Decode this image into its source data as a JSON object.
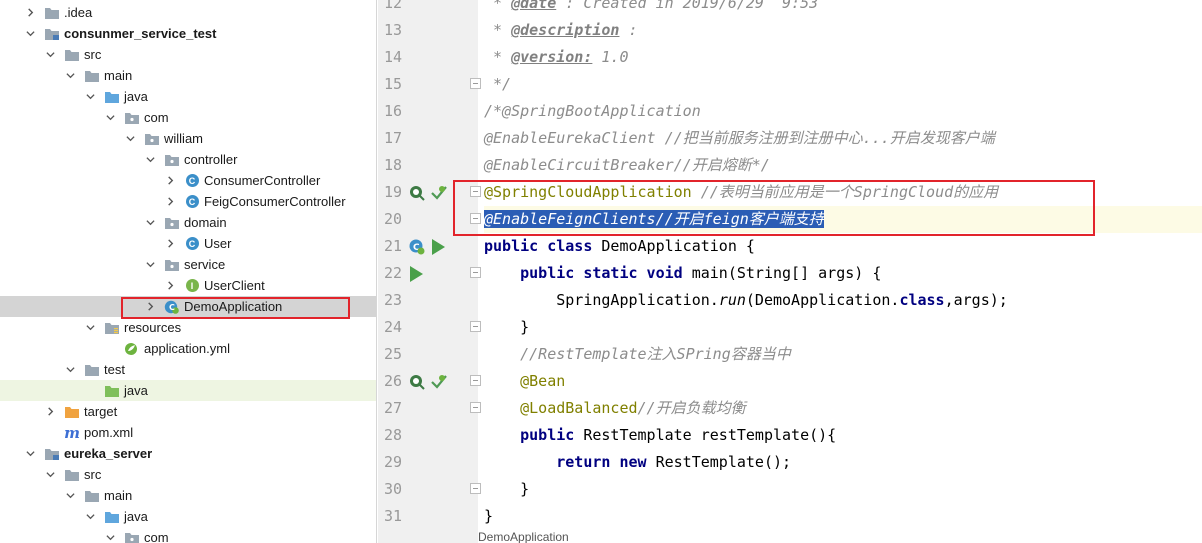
{
  "tree": {
    "items": [
      {
        "label": ".idea",
        "indent": 0,
        "arrow": "right",
        "icon": "folder-plain",
        "bold": false
      },
      {
        "label": "consunmer_service_test",
        "indent": 0,
        "arrow": "down",
        "icon": "folder-module",
        "bold": true
      },
      {
        "label": "src",
        "indent": 1,
        "arrow": "down",
        "icon": "folder-plain",
        "bold": false
      },
      {
        "label": "main",
        "indent": 2,
        "arrow": "down",
        "icon": "folder-plain",
        "bold": false
      },
      {
        "label": "java",
        "indent": 3,
        "arrow": "down",
        "icon": "folder-source",
        "bold": false
      },
      {
        "label": "com",
        "indent": 4,
        "arrow": "down",
        "icon": "folder-package",
        "bold": false
      },
      {
        "label": "william",
        "indent": 5,
        "arrow": "down",
        "icon": "folder-package",
        "bold": false
      },
      {
        "label": "controller",
        "indent": 6,
        "arrow": "down",
        "icon": "folder-package",
        "bold": false
      },
      {
        "label": "ConsumerController",
        "indent": 7,
        "arrow": "right",
        "icon": "class",
        "bold": false
      },
      {
        "label": "FeigConsumerController",
        "indent": 7,
        "arrow": "right",
        "icon": "class",
        "bold": false
      },
      {
        "label": "domain",
        "indent": 6,
        "arrow": "down",
        "icon": "folder-package",
        "bold": false
      },
      {
        "label": "User",
        "indent": 7,
        "arrow": "right",
        "icon": "class",
        "bold": false
      },
      {
        "label": "service",
        "indent": 6,
        "arrow": "down",
        "icon": "folder-package",
        "bold": false
      },
      {
        "label": "UserClient",
        "indent": 7,
        "arrow": "right",
        "icon": "interface",
        "bold": false
      },
      {
        "label": "DemoApplication",
        "indent": 6,
        "arrow": "right",
        "icon": "spring-class",
        "bold": false,
        "selected": true
      },
      {
        "label": "resources",
        "indent": 3,
        "arrow": "down",
        "icon": "folder-resources",
        "bold": false
      },
      {
        "label": "application.yml",
        "indent": 4,
        "arrow": "none",
        "icon": "spring-yml",
        "bold": false
      },
      {
        "label": "test",
        "indent": 2,
        "arrow": "down",
        "icon": "folder-plain",
        "bold": false
      },
      {
        "label": "java",
        "indent": 3,
        "arrow": "none",
        "icon": "folder-test",
        "bold": false,
        "green": true
      },
      {
        "label": "target",
        "indent": 1,
        "arrow": "right",
        "icon": "folder-target",
        "bold": false
      },
      {
        "label": "pom.xml",
        "indent": 1,
        "arrow": "none",
        "icon": "maven",
        "bold": false
      },
      {
        "label": "eureka_server",
        "indent": 0,
        "arrow": "down",
        "icon": "folder-module",
        "bold": true
      },
      {
        "label": "src",
        "indent": 1,
        "arrow": "down",
        "icon": "folder-plain",
        "bold": false
      },
      {
        "label": "main",
        "indent": 2,
        "arrow": "down",
        "icon": "folder-plain",
        "bold": false
      },
      {
        "label": "java",
        "indent": 3,
        "arrow": "down",
        "icon": "folder-source",
        "bold": false
      },
      {
        "label": "com",
        "indent": 4,
        "arrow": "down",
        "icon": "folder-package",
        "bold": false
      }
    ]
  },
  "editor": {
    "lines": [
      {
        "num": "12",
        "parts": [
          {
            "t": " * ",
            "c": "cm"
          },
          {
            "t": "@date",
            "c": "tag"
          },
          {
            "t": " : Created in 2019/6/29  9:53",
            "c": "cm"
          }
        ],
        "fold": false,
        "icons": []
      },
      {
        "num": "13",
        "parts": [
          {
            "t": " * ",
            "c": "cm"
          },
          {
            "t": "@description",
            "c": "tag"
          },
          {
            "t": " :",
            "c": "cm"
          }
        ],
        "fold": false,
        "icons": []
      },
      {
        "num": "14",
        "parts": [
          {
            "t": " * ",
            "c": "cm"
          },
          {
            "t": "@version:",
            "c": "tag"
          },
          {
            "t": " 1.0",
            "c": "cm"
          }
        ],
        "fold": false,
        "icons": []
      },
      {
        "num": "15",
        "parts": [
          {
            "t": " */",
            "c": "cm"
          }
        ],
        "fold": true,
        "icons": []
      },
      {
        "num": "16",
        "parts": [
          {
            "t": "/*@SpringBootApplication",
            "c": "cm"
          }
        ],
        "fold": false,
        "icons": []
      },
      {
        "num": "17",
        "parts": [
          {
            "t": "@EnableEurekaClient //把当前服务注册到注册中心...开启发现客户端",
            "c": "cm"
          }
        ],
        "fold": false,
        "icons": []
      },
      {
        "num": "18",
        "parts": [
          {
            "t": "@EnableCircuitBreaker//开启熔断*/",
            "c": "cm"
          }
        ],
        "fold": false,
        "icons": []
      },
      {
        "num": "19",
        "parts": [
          {
            "t": "@SpringCloudApplication",
            "c": "ann"
          },
          {
            "t": " //表明当前应用是一个SpringCloud的应用",
            "c": "cm"
          }
        ],
        "fold": true,
        "icons": [
          "bean-search-icon",
          "bean-check-icon"
        ]
      },
      {
        "num": "20",
        "parts": [
          {
            "t": "@EnableFeignClients//开启feign客户端支持",
            "c": "sel"
          }
        ],
        "fold": true,
        "icons": [],
        "current": true
      },
      {
        "num": "21",
        "parts": [
          {
            "t": "public class",
            "c": "kw"
          },
          {
            "t": " DemoApplication {",
            "c": ""
          }
        ],
        "fold": false,
        "icons": [
          "spring-class-icon",
          "run-icon"
        ]
      },
      {
        "num": "22",
        "parts": [
          {
            "t": "    ",
            "c": "dot"
          },
          {
            "t": "public static void",
            "c": "kw"
          },
          {
            "t": " main(String[] args) {",
            "c": ""
          }
        ],
        "fold": true,
        "icons": [
          "run-icon"
        ]
      },
      {
        "num": "23",
        "parts": [
          {
            "t": "        SpringApplication.",
            "c": ""
          },
          {
            "t": "run",
            "c": "meth"
          },
          {
            "t": "(DemoApplication.",
            "c": ""
          },
          {
            "t": "class",
            "c": "kw"
          },
          {
            "t": ",args);",
            "c": ""
          }
        ],
        "fold": false,
        "icons": []
      },
      {
        "num": "24",
        "parts": [
          {
            "t": "    }",
            "c": ""
          }
        ],
        "fold": true,
        "icons": []
      },
      {
        "num": "25",
        "parts": [
          {
            "t": "    ",
            "c": "dot"
          },
          {
            "t": "//RestTemplate注入SPring容器当中",
            "c": "cm"
          }
        ],
        "fold": false,
        "icons": []
      },
      {
        "num": "26",
        "parts": [
          {
            "t": "    ",
            "c": "dot"
          },
          {
            "t": "@Bean",
            "c": "ann"
          }
        ],
        "fold": true,
        "icons": [
          "bean-search-icon",
          "bean-check-icon"
        ]
      },
      {
        "num": "27",
        "parts": [
          {
            "t": "    ",
            "c": "dot"
          },
          {
            "t": "@LoadBalanced",
            "c": "ann"
          },
          {
            "t": "//开启负载均衡",
            "c": "cm"
          }
        ],
        "fold": true,
        "icons": []
      },
      {
        "num": "28",
        "parts": [
          {
            "t": "    ",
            "c": "dot"
          },
          {
            "t": "public",
            "c": "kw"
          },
          {
            "t": " RestTemplate restTemplate(){",
            "c": ""
          }
        ],
        "fold": false,
        "icons": []
      },
      {
        "num": "29",
        "parts": [
          {
            "t": "        ",
            "c": "dot"
          },
          {
            "t": "return new",
            "c": "kw"
          },
          {
            "t": " RestTemplate();",
            "c": ""
          }
        ],
        "fold": false,
        "icons": []
      },
      {
        "num": "30",
        "parts": [
          {
            "t": "    }",
            "c": ""
          }
        ],
        "fold": true,
        "icons": []
      },
      {
        "num": "31",
        "parts": [
          {
            "t": "}",
            "c": ""
          }
        ],
        "fold": false,
        "icons": []
      }
    ]
  },
  "status": {
    "breadcrumb": "DemoApplication"
  },
  "colors": {
    "selection": "#2b5db5",
    "highlight_box": "#e2242b",
    "annotation": "#808000",
    "keyword": "#000080",
    "comment": "#8c8c8c"
  }
}
